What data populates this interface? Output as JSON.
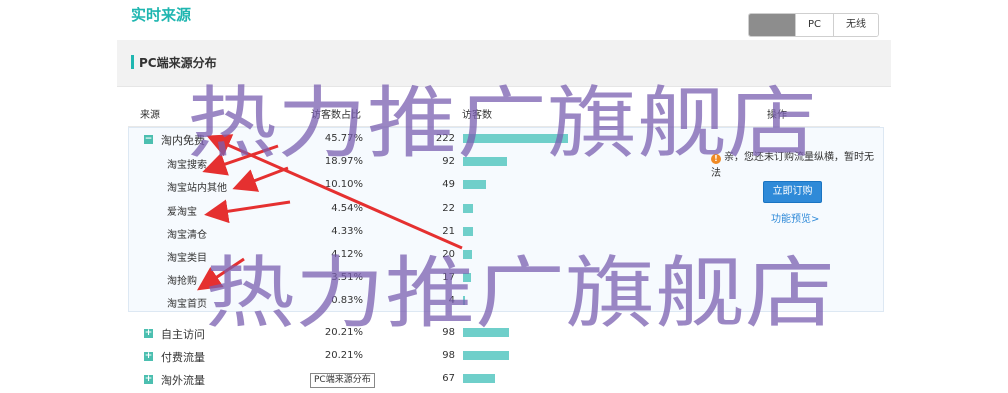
{
  "header": {
    "title": "实时来源",
    "tabs": [
      "",
      "PC",
      "无线"
    ]
  },
  "panel": {
    "title": "PC端来源分布"
  },
  "table": {
    "columns": {
      "source": "来源",
      "ratio": "访客数占比",
      "visitors": "访客数",
      "action": "操作"
    },
    "rows": [
      {
        "name": "淘内免费",
        "pct": "45.77%",
        "count": "222",
        "level": 1,
        "toggle": "−",
        "share": 0.4577
      },
      {
        "name": "淘宝搜索",
        "pct": "18.97%",
        "count": "92",
        "level": 2,
        "share": 0.1897
      },
      {
        "name": "淘宝站内其他",
        "pct": "10.10%",
        "count": "49",
        "level": 2,
        "share": 0.101
      },
      {
        "name": "爱淘宝",
        "pct": "4.54%",
        "count": "22",
        "level": 2,
        "share": 0.0454
      },
      {
        "name": "淘宝清仓",
        "pct": "4.33%",
        "count": "21",
        "level": 2,
        "share": 0.0433
      },
      {
        "name": "淘宝类目",
        "pct": "4.12%",
        "count": "20",
        "level": 2,
        "share": 0.0412
      },
      {
        "name": "淘抢购",
        "pct": "3.51%",
        "count": "17",
        "level": 2,
        "share": 0.0351
      },
      {
        "name": "淘宝首页",
        "pct": "0.83%",
        "count": "4",
        "level": 2,
        "share": 0.0083
      },
      {
        "name": "自主访问",
        "pct": "20.21%",
        "count": "98",
        "level": 1,
        "toggle": "+",
        "share": 0.2021
      },
      {
        "name": "付费流量",
        "pct": "20.21%",
        "count": "98",
        "level": 1,
        "toggle": "+",
        "share": 0.2021
      },
      {
        "name": "淘外流量",
        "pct": "13.81%",
        "count": "67",
        "level": 1,
        "toggle": "+",
        "share": 0.1381
      }
    ]
  },
  "notice": {
    "icon": "warning-icon",
    "line1": "亲，您还未订购流量纵横，暂时无法",
    "line2": "使用！",
    "button": "立即订购",
    "link": "功能预览>"
  },
  "tooltip": "PC端来源分布",
  "watermark": "热力推广旗舰店",
  "colors": {
    "accent": "#1fb6b0",
    "bar": "#6fcfca",
    "button": "#2f8ad8",
    "arrow": "#e53030",
    "watermark": "#7a5fb0"
  }
}
